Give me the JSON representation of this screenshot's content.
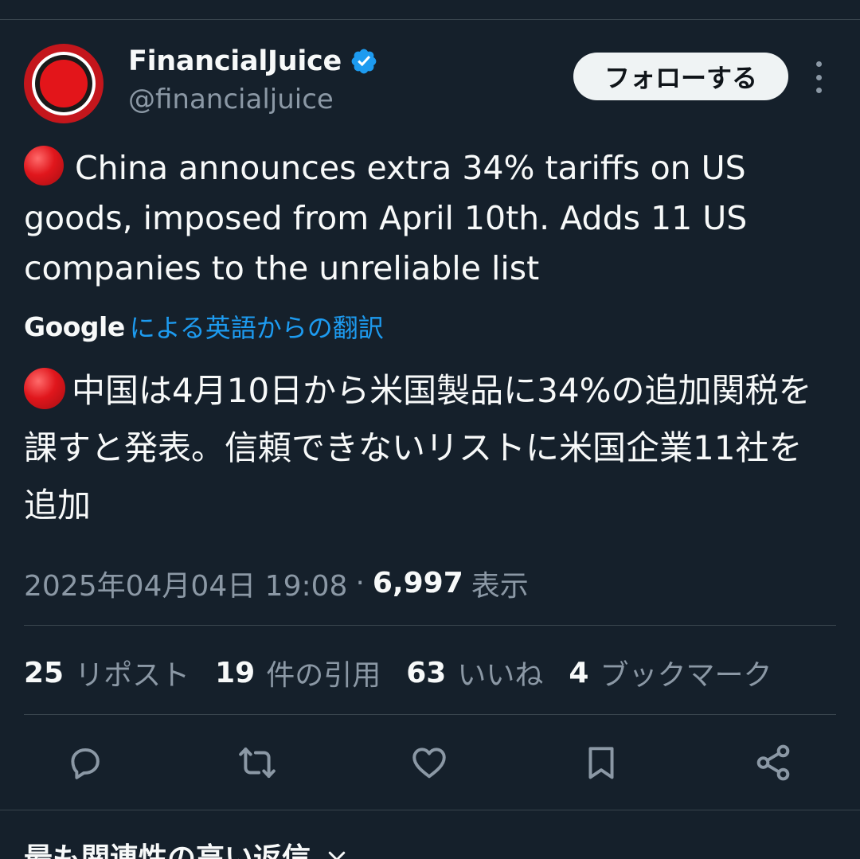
{
  "account": {
    "display_name": "FinancialJuice",
    "handle": "@financialjuice",
    "avatar": "financialjuice-logo",
    "verified_icon": "verified-badge-icon",
    "verified_color": "#1d9bf0"
  },
  "header": {
    "follow_label": "フォローする",
    "more_icon": "more-vertical-icon"
  },
  "tweet": {
    "emoji": "red-circle",
    "text": "China announces extra 34% tariffs on US goods, imposed from April 10th. Adds 11 US companies to the unreliable list",
    "translation_source": "Google",
    "translation_label": "による英語からの翻訳",
    "translated_text": "中国は4月10日から米国製品に34%の追加関税を課すと発表。信頼できないリストに米国企業11社を追加",
    "timestamp": "2025年04月04日 19:08",
    "separator": "·",
    "views_count": "6,997",
    "views_label": "表示"
  },
  "stats": [
    {
      "count": "25",
      "label": "リポスト"
    },
    {
      "count": "19",
      "label": "件の引用"
    },
    {
      "count": "63",
      "label": "いいね"
    },
    {
      "count": "4",
      "label": "ブックマーク"
    }
  ],
  "actions": [
    "reply-icon",
    "retweet-icon",
    "like-icon",
    "bookmark-icon",
    "share-icon"
  ],
  "replies": {
    "sort_label": "最も関連性の高い返信",
    "chevron": "chevron-down-icon"
  },
  "colors": {
    "background": "#15202b",
    "text": "#f7f9f9",
    "secondary_text": "#8b98a5",
    "accent": "#1d9bf0",
    "divider": "#38444d"
  }
}
